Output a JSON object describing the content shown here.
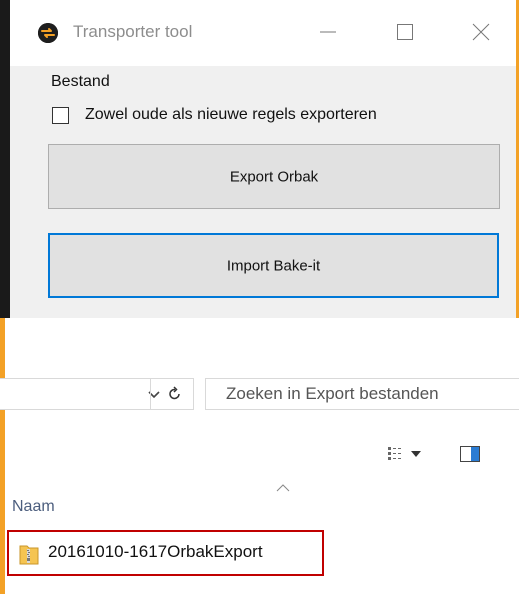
{
  "window": {
    "title": "Transporter tool",
    "icon": "transporter-app-icon",
    "controls": [
      "minimize-icon",
      "maximize-icon",
      "close-icon"
    ],
    "menu": [
      "Bestand"
    ],
    "checkbox": {
      "label": "Zowel oude als nieuwe regels exporteren",
      "checked": false
    },
    "buttons": {
      "export": "Export Orbak",
      "import": "Import Bake-it"
    }
  },
  "explorer": {
    "search_placeholder": "Zoeken in Export bestanden",
    "column_header": "Naam",
    "files": [
      {
        "name": "20161010-1617OrbakExport",
        "icon": "zip-folder-icon"
      }
    ]
  },
  "colors": {
    "accent_blue": "#0078d7",
    "highlight_red": "#c00000",
    "orange_edge": "#f3a126"
  }
}
